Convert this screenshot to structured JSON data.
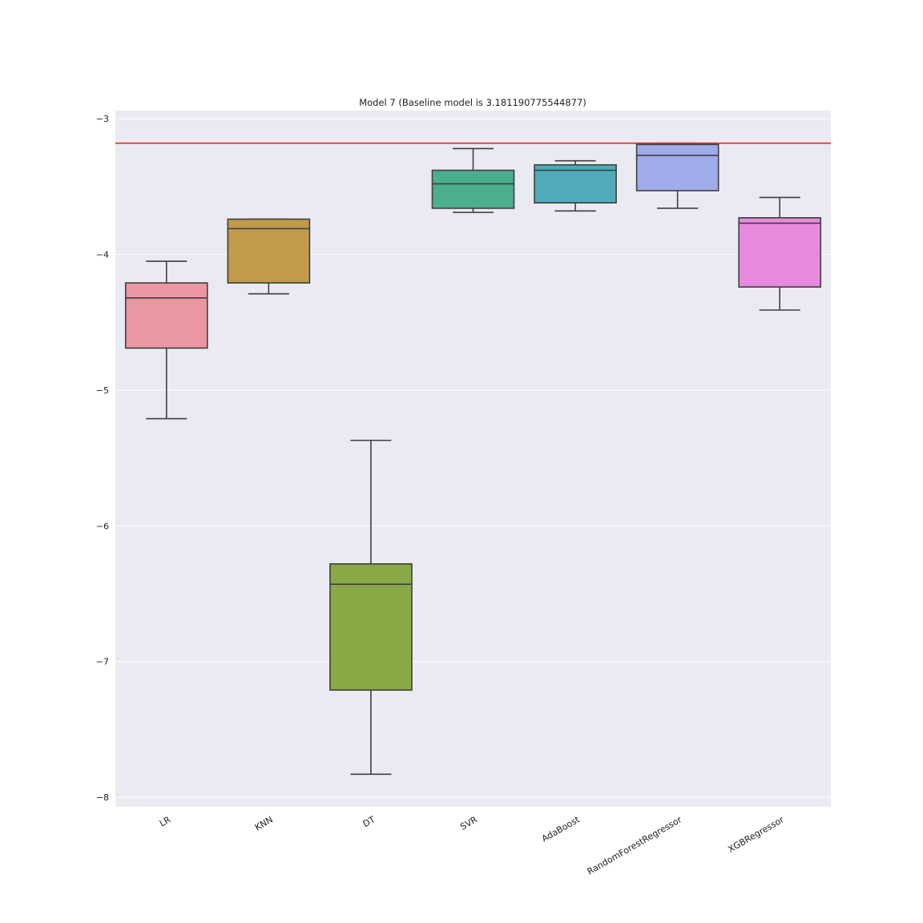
{
  "chart_data": {
    "type": "box",
    "title": "Model 7 (Baseline model is 3.181190775544877)",
    "xlabel": "",
    "ylabel": "",
    "ylim": [
      -8.07,
      -2.94
    ],
    "yticks": [
      -3,
      -4,
      -5,
      -6,
      -7,
      -8
    ],
    "ytick_labels": [
      "−3",
      "−4",
      "−5",
      "−6",
      "−7",
      "−8"
    ],
    "grid": true,
    "baseline": -3.18,
    "baseline_color": "#e8231c",
    "categories": [
      "LR",
      "KNN",
      "DT",
      "SVR",
      "AdaBoost",
      "RandomForestRegressor",
      "XGBRegressor"
    ],
    "boxes": [
      {
        "name": "LR",
        "whisker_low": -5.21,
        "q1": -4.69,
        "median": -4.32,
        "q3": -4.21,
        "whisker_high": -4.05,
        "color": "#eb97a2"
      },
      {
        "name": "KNN",
        "whisker_low": -4.29,
        "q1": -4.21,
        "median": -3.81,
        "q3": -3.74,
        "whisker_high": -3.74,
        "color": "#c19a4c"
      },
      {
        "name": "DT",
        "whisker_low": -7.83,
        "q1": -7.21,
        "median": -6.43,
        "q3": -6.28,
        "whisker_high": -5.37,
        "color": "#89a946"
      },
      {
        "name": "SVR",
        "whisker_low": -3.69,
        "q1": -3.66,
        "median": -3.48,
        "q3": -3.38,
        "whisker_high": -3.22,
        "color": "#4bae8e"
      },
      {
        "name": "AdaBoost",
        "whisker_low": -3.68,
        "q1": -3.62,
        "median": -3.38,
        "q3": -3.34,
        "whisker_high": -3.31,
        "color": "#4fabbb"
      },
      {
        "name": "RandomForestRegressor",
        "whisker_low": -3.66,
        "q1": -3.53,
        "median": -3.27,
        "q3": -3.19,
        "whisker_high": -3.18,
        "color": "#a0abea"
      },
      {
        "name": "XGBRegressor",
        "whisker_low": -4.41,
        "q1": -4.24,
        "median": -3.77,
        "q3": -3.73,
        "whisker_high": -3.58,
        "color": "#e78ade"
      }
    ]
  }
}
